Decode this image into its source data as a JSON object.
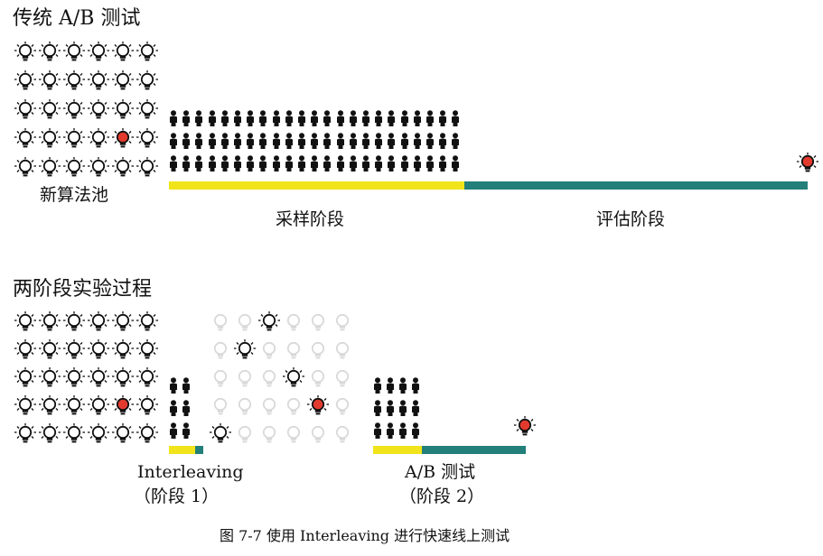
{
  "figure": {
    "caption": "图 7-7    使用 Interleaving 进行快速线上测试",
    "colors": {
      "ink": "#111111",
      "faded_bulb": "#d9d9d9",
      "highlight_bulb": "#e23b2e",
      "sampling_bar": "#f2e41b",
      "evaluation_bar": "#237f7a"
    },
    "icons": [
      "light-bulb-icon",
      "person-icon"
    ]
  },
  "traditional": {
    "title": "传统 A/B 测试",
    "pool_label": "新算法池",
    "pool_grid": {
      "rows": 5,
      "cols": 6,
      "highlight": {
        "row": 3,
        "col": 4
      }
    },
    "people_grid": {
      "rows": 3,
      "cols": 23
    },
    "phase_sampling": "采样阶段",
    "phase_evaluation": "评估阶段",
    "sampling_share": 0.46
  },
  "two_stage": {
    "title": "两阶段实验过程",
    "pool_grid": {
      "rows": 5,
      "cols": 6,
      "highlight": {
        "row": 3,
        "col": 4
      }
    },
    "interleaving": {
      "label": "Interleaving",
      "stage": "（阶段 1）",
      "people_grid": {
        "rows": 3,
        "cols": 2
      },
      "candidates_grid": {
        "rows": 5,
        "cols": 6
      },
      "selected": [
        [
          0,
          2
        ],
        [
          1,
          1
        ],
        [
          2,
          3
        ],
        [
          3,
          4
        ],
        [
          4,
          0
        ]
      ],
      "red": [
        3,
        4
      ]
    },
    "ab": {
      "label": "A/B 测试",
      "stage": "（阶段 2）",
      "people_grid": {
        "rows": 3,
        "cols": 4
      }
    }
  }
}
